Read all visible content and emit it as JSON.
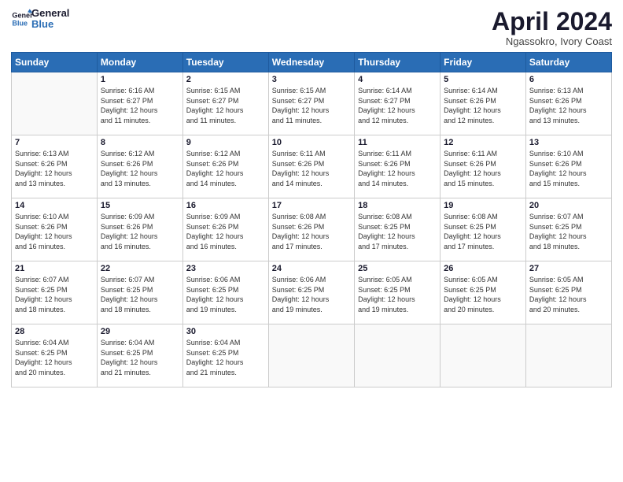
{
  "logo": {
    "line1": "General",
    "line2": "Blue"
  },
  "title": "April 2024",
  "subtitle": "Ngassokro, Ivory Coast",
  "weekdays": [
    "Sunday",
    "Monday",
    "Tuesday",
    "Wednesday",
    "Thursday",
    "Friday",
    "Saturday"
  ],
  "weeks": [
    [
      {
        "day": "",
        "info": ""
      },
      {
        "day": "1",
        "info": "Sunrise: 6:16 AM\nSunset: 6:27 PM\nDaylight: 12 hours\nand 11 minutes."
      },
      {
        "day": "2",
        "info": "Sunrise: 6:15 AM\nSunset: 6:27 PM\nDaylight: 12 hours\nand 11 minutes."
      },
      {
        "day": "3",
        "info": "Sunrise: 6:15 AM\nSunset: 6:27 PM\nDaylight: 12 hours\nand 11 minutes."
      },
      {
        "day": "4",
        "info": "Sunrise: 6:14 AM\nSunset: 6:27 PM\nDaylight: 12 hours\nand 12 minutes."
      },
      {
        "day": "5",
        "info": "Sunrise: 6:14 AM\nSunset: 6:26 PM\nDaylight: 12 hours\nand 12 minutes."
      },
      {
        "day": "6",
        "info": "Sunrise: 6:13 AM\nSunset: 6:26 PM\nDaylight: 12 hours\nand 13 minutes."
      }
    ],
    [
      {
        "day": "7",
        "info": "Sunrise: 6:13 AM\nSunset: 6:26 PM\nDaylight: 12 hours\nand 13 minutes."
      },
      {
        "day": "8",
        "info": "Sunrise: 6:12 AM\nSunset: 6:26 PM\nDaylight: 12 hours\nand 13 minutes."
      },
      {
        "day": "9",
        "info": "Sunrise: 6:12 AM\nSunset: 6:26 PM\nDaylight: 12 hours\nand 14 minutes."
      },
      {
        "day": "10",
        "info": "Sunrise: 6:11 AM\nSunset: 6:26 PM\nDaylight: 12 hours\nand 14 minutes."
      },
      {
        "day": "11",
        "info": "Sunrise: 6:11 AM\nSunset: 6:26 PM\nDaylight: 12 hours\nand 14 minutes."
      },
      {
        "day": "12",
        "info": "Sunrise: 6:11 AM\nSunset: 6:26 PM\nDaylight: 12 hours\nand 15 minutes."
      },
      {
        "day": "13",
        "info": "Sunrise: 6:10 AM\nSunset: 6:26 PM\nDaylight: 12 hours\nand 15 minutes."
      }
    ],
    [
      {
        "day": "14",
        "info": "Sunrise: 6:10 AM\nSunset: 6:26 PM\nDaylight: 12 hours\nand 16 minutes."
      },
      {
        "day": "15",
        "info": "Sunrise: 6:09 AM\nSunset: 6:26 PM\nDaylight: 12 hours\nand 16 minutes."
      },
      {
        "day": "16",
        "info": "Sunrise: 6:09 AM\nSunset: 6:26 PM\nDaylight: 12 hours\nand 16 minutes."
      },
      {
        "day": "17",
        "info": "Sunrise: 6:08 AM\nSunset: 6:26 PM\nDaylight: 12 hours\nand 17 minutes."
      },
      {
        "day": "18",
        "info": "Sunrise: 6:08 AM\nSunset: 6:25 PM\nDaylight: 12 hours\nand 17 minutes."
      },
      {
        "day": "19",
        "info": "Sunrise: 6:08 AM\nSunset: 6:25 PM\nDaylight: 12 hours\nand 17 minutes."
      },
      {
        "day": "20",
        "info": "Sunrise: 6:07 AM\nSunset: 6:25 PM\nDaylight: 12 hours\nand 18 minutes."
      }
    ],
    [
      {
        "day": "21",
        "info": "Sunrise: 6:07 AM\nSunset: 6:25 PM\nDaylight: 12 hours\nand 18 minutes."
      },
      {
        "day": "22",
        "info": "Sunrise: 6:07 AM\nSunset: 6:25 PM\nDaylight: 12 hours\nand 18 minutes."
      },
      {
        "day": "23",
        "info": "Sunrise: 6:06 AM\nSunset: 6:25 PM\nDaylight: 12 hours\nand 19 minutes."
      },
      {
        "day": "24",
        "info": "Sunrise: 6:06 AM\nSunset: 6:25 PM\nDaylight: 12 hours\nand 19 minutes."
      },
      {
        "day": "25",
        "info": "Sunrise: 6:05 AM\nSunset: 6:25 PM\nDaylight: 12 hours\nand 19 minutes."
      },
      {
        "day": "26",
        "info": "Sunrise: 6:05 AM\nSunset: 6:25 PM\nDaylight: 12 hours\nand 20 minutes."
      },
      {
        "day": "27",
        "info": "Sunrise: 6:05 AM\nSunset: 6:25 PM\nDaylight: 12 hours\nand 20 minutes."
      }
    ],
    [
      {
        "day": "28",
        "info": "Sunrise: 6:04 AM\nSunset: 6:25 PM\nDaylight: 12 hours\nand 20 minutes."
      },
      {
        "day": "29",
        "info": "Sunrise: 6:04 AM\nSunset: 6:25 PM\nDaylight: 12 hours\nand 21 minutes."
      },
      {
        "day": "30",
        "info": "Sunrise: 6:04 AM\nSunset: 6:25 PM\nDaylight: 12 hours\nand 21 minutes."
      },
      {
        "day": "",
        "info": ""
      },
      {
        "day": "",
        "info": ""
      },
      {
        "day": "",
        "info": ""
      },
      {
        "day": "",
        "info": ""
      }
    ]
  ]
}
